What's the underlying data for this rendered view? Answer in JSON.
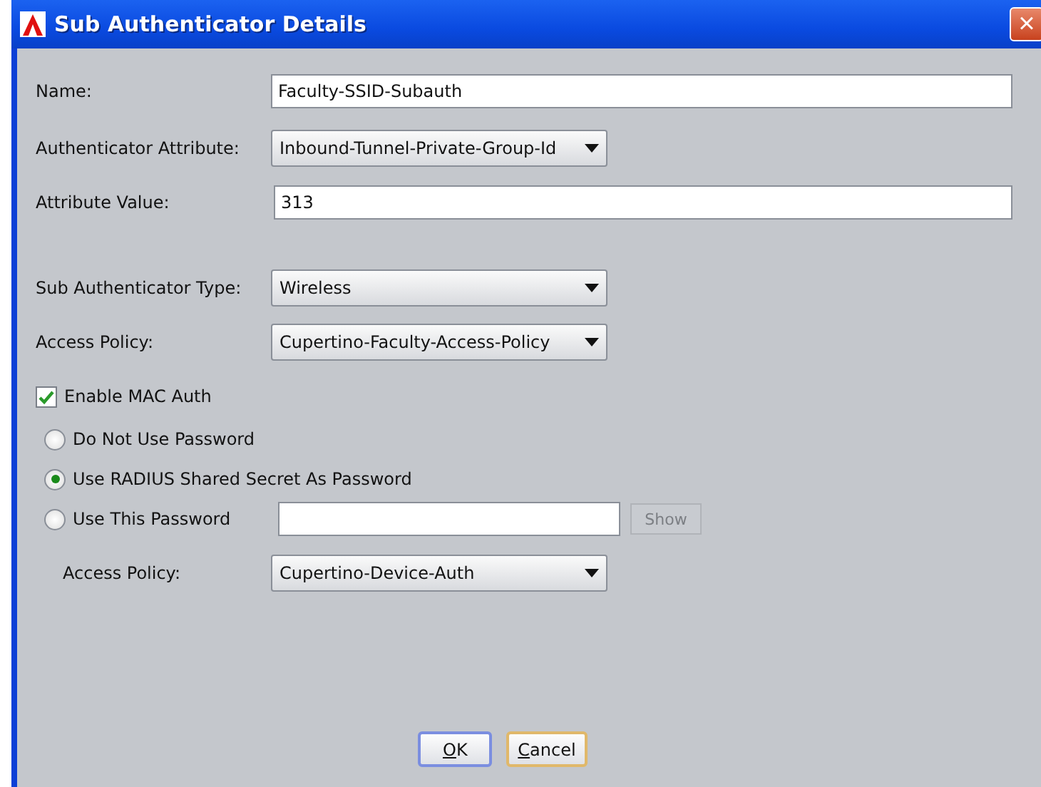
{
  "window": {
    "title": "Sub Authenticator Details",
    "close": "×"
  },
  "fields": [
    {
      "kind": "text",
      "label": "Name:",
      "value": "Faculty-SSID-Subauth"
    },
    {
      "kind": "select",
      "label": "Authenticator Attribute:",
      "value": "Inbound-Tunnel-Private-Group-Id"
    },
    {
      "kind": "text",
      "label": "Attribute Value:",
      "value": "313"
    },
    {
      "kind": "gap"
    },
    {
      "kind": "select",
      "label": "Sub Authenticator Type:",
      "value": "Wireless"
    },
    {
      "kind": "select",
      "label": "Access Policy:",
      "value": "Cupertino-Faculty-Access-Policy"
    }
  ],
  "mac_auth": {
    "label": "Enable MAC Auth",
    "checked": true
  },
  "password_options": [
    {
      "kind": "plain",
      "label": "Do Not Use Password",
      "selected": false
    },
    {
      "kind": "plain",
      "label": "Use RADIUS Shared Secret As Password",
      "selected": true
    },
    {
      "kind": "with_field",
      "label": "Use This Password",
      "selected": false
    }
  ],
  "show_button": {
    "label": "Show",
    "disabled": true
  },
  "mac_access_policy": {
    "label": "Access Policy:",
    "value": "Cupertino-Device-Auth"
  },
  "buttons": [
    {
      "label": "OK",
      "default": true
    },
    {
      "label": "Cancel",
      "default": false
    }
  ]
}
